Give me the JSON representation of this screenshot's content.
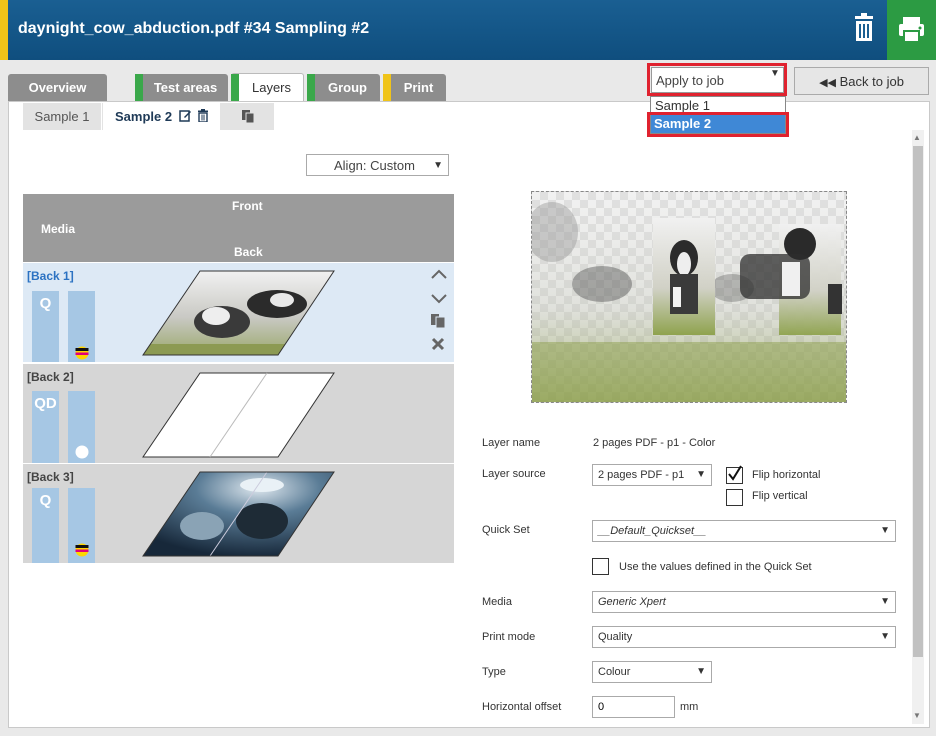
{
  "header": {
    "title": "daynight_cow_abduction.pdf #34 Sampling #2"
  },
  "tabs": [
    {
      "label": "Overview",
      "accent": ""
    },
    {
      "label": "Test areas",
      "accent": "#3aa84a"
    },
    {
      "label": "Layers",
      "accent": "#3aa84a"
    },
    {
      "label": "Group",
      "accent": "#3aa84a"
    },
    {
      "label": "Print",
      "accent": "#f0c419"
    }
  ],
  "apply": {
    "selected": "Apply to job",
    "options": [
      "Sample 1",
      "Sample 2"
    ]
  },
  "back_label": "Back to job",
  "subtabs": {
    "sample1": "Sample 1",
    "sample2": "Sample 2"
  },
  "align": {
    "label": "Align: Custom"
  },
  "media_table": {
    "media": "Media",
    "front": "Front",
    "back": "Back",
    "rows": [
      {
        "label": "[Back 1]",
        "mode": "Q"
      },
      {
        "label": "[Back 2]",
        "mode": "QD"
      },
      {
        "label": "[Back 3]",
        "mode": "Q"
      }
    ]
  },
  "layer": {
    "name_label": "Layer name",
    "name_value": "2 pages PDF - p1 - Color",
    "source_label": "Layer source",
    "source_value": "2 pages PDF - p1",
    "flip_h": "Flip horizontal",
    "flip_v": "Flip vertical",
    "quickset_label": "Quick Set",
    "quickset_value": "__Default_Quickset__",
    "use_values": "Use the values defined in the Quick Set",
    "media_label": "Media",
    "media_value": "Generic Xpert",
    "printmode_label": "Print mode",
    "printmode_value": "Quality",
    "type_label": "Type",
    "type_value": "Colour",
    "hoffset_label": "Horizontal offset",
    "hoffset_value": "0",
    "hoffset_unit": "mm"
  },
  "colors": {
    "header": "#12548a",
    "accent_yellow": "#f0c419",
    "green": "#2c9b43",
    "highlight": "#e0222f",
    "selected": "#3f88d6"
  }
}
